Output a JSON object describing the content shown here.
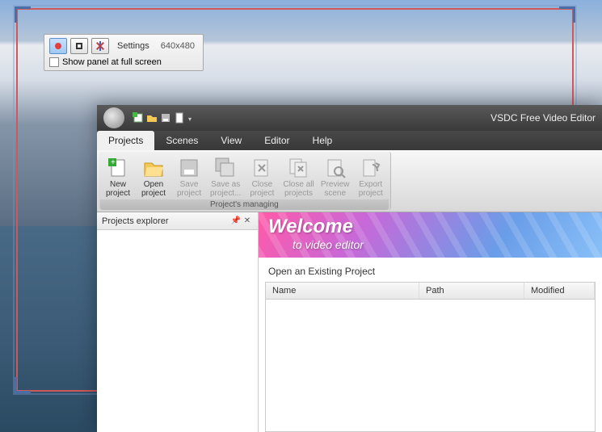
{
  "recorder": {
    "settings_label": "Settings",
    "resolution": "640x480",
    "fullscreen_label": "Show panel at full screen",
    "icons": {
      "record": "record-icon",
      "fullscreen_toggle": "frame-icon",
      "tools": "tools-cross-icon"
    }
  },
  "app": {
    "title": "VSDC Free Video Editor",
    "menus": [
      "Projects",
      "Scenes",
      "View",
      "Editor",
      "Help"
    ],
    "active_menu_index": 0,
    "ribbon": {
      "group_title": "Project's managing",
      "buttons": [
        {
          "label": "New\nproject",
          "icon": "new-project-icon",
          "enabled": true
        },
        {
          "label": "Open\nproject",
          "icon": "open-project-icon",
          "enabled": true
        },
        {
          "label": "Save\nproject",
          "icon": "save-project-icon",
          "enabled": false
        },
        {
          "label": "Save as\nproject...",
          "icon": "save-as-project-icon",
          "enabled": false
        },
        {
          "label": "Close\nproject",
          "icon": "close-project-icon",
          "enabled": false
        },
        {
          "label": "Close all\nprojects",
          "icon": "close-all-projects-icon",
          "enabled": false
        },
        {
          "label": "Preview\nscene",
          "icon": "preview-scene-icon",
          "enabled": false
        },
        {
          "label": "Export\nproject",
          "icon": "export-project-icon",
          "enabled": false
        }
      ]
    },
    "explorer": {
      "title": "Projects explorer"
    },
    "welcome": {
      "title": "Welcome",
      "subtitle": "to video editor"
    },
    "open_existing": {
      "heading": "Open an Existing Project",
      "columns": [
        "Name",
        "Path",
        "Modified"
      ]
    }
  }
}
